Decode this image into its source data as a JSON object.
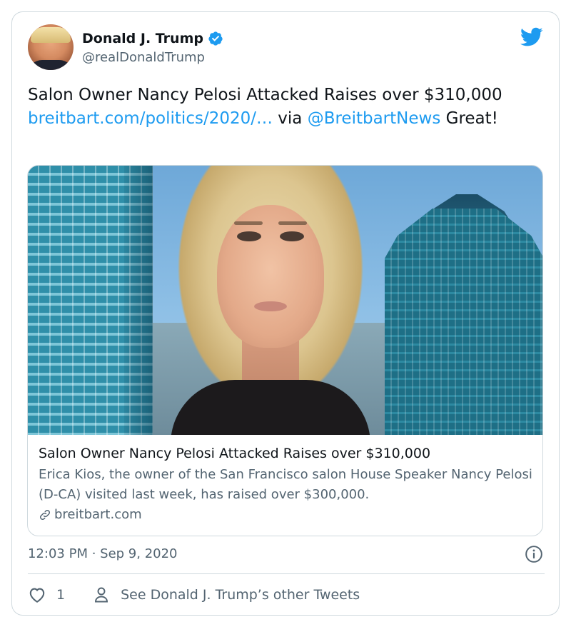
{
  "author": {
    "display_name": "Donald J. Trump",
    "handle": "@realDonaldTrump",
    "verified": true,
    "avatar_icon": "avatar-photo"
  },
  "brand_icon": "twitter-bird-icon",
  "colors": {
    "accent": "#1d9bf0",
    "text": "#0f1419",
    "muted": "#536471",
    "border": "#cfd9de"
  },
  "tweet": {
    "text_part1": "Salon Owner Nancy Pelosi Attacked Raises over $310,000 ",
    "link_text": "breitbart.com/politics/2020/…",
    "text_part2": " via ",
    "mention": "@BreitbartNews",
    "text_part3": " Great!"
  },
  "link_card": {
    "title": "Salon Owner Nancy Pelosi Attacked Raises over $310,000",
    "description": "Erica Kios, the owner of the San Francisco salon House Speaker Nancy Pelosi (D-CA) visited last week, has raised over $300,000.",
    "domain": "breitbart.com"
  },
  "meta": {
    "timestamp": "12:03 PM · Sep 9, 2020"
  },
  "actions": {
    "like_count": "1",
    "other_tweets_label": "See Donald J. Trump’s other Tweets"
  }
}
